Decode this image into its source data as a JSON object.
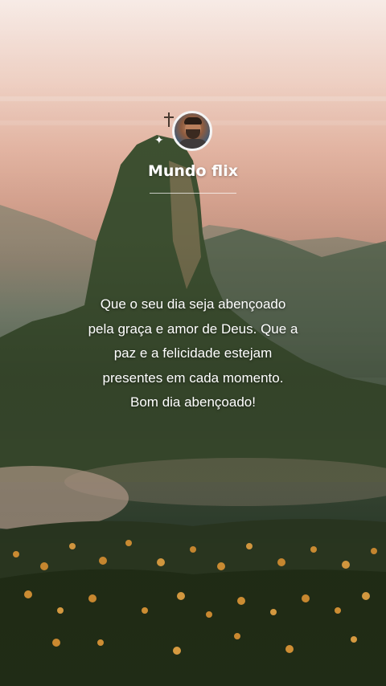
{
  "profile": {
    "channel_name": "Mundo flix",
    "sparkle": "✦"
  },
  "message": {
    "lines": [
      "Que o seu dia seja abençoado",
      "pela graça e amor de Deus. Que a",
      "paz e a felicidade estejam",
      "presentes em cada momento.",
      "Bom dia abençoado!"
    ]
  },
  "colors": {
    "text": "#ffffff",
    "sky_top": "#f7ebe6",
    "sky_mid": "#e9b9a6",
    "foliage": "#334331",
    "flower": "#e8a03a"
  }
}
